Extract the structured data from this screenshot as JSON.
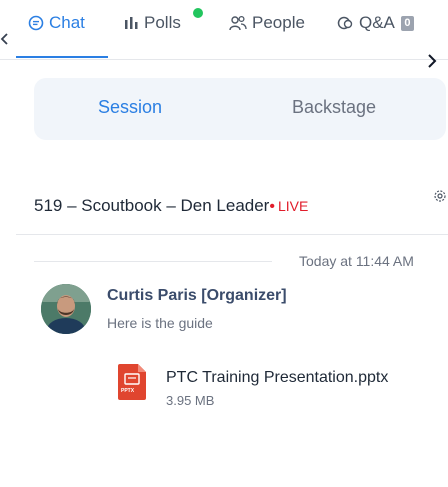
{
  "tabs": {
    "chat": "Chat",
    "polls": "Polls",
    "people": "People",
    "qa": "Q&A",
    "qa_count": "0",
    "active": "Chat",
    "accent_color": "#2b7fe3",
    "poll_indicator_color": "#22c55e"
  },
  "segment": {
    "session": "Session",
    "backstage": "Backstage",
    "active": "Session"
  },
  "session": {
    "title": "519 – Scoutbook – Den Leader",
    "live_label": "LIVE",
    "live_color": "#e11d2b"
  },
  "messages": [
    {
      "time": "Today at 11:44 AM",
      "sender": "Curtis Paris [Organizer]",
      "text": "Here is the guide",
      "attachment": {
        "name": "PTC Training Presentation.pptx",
        "size": "3.95 MB",
        "type_badge": "PPTX",
        "icon": "pptx-file-icon"
      }
    }
  ]
}
